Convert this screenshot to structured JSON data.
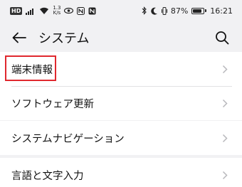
{
  "status_bar": {
    "badge": "HD",
    "speed_value": "1.3",
    "speed_unit": "K/s",
    "battery": "87%",
    "time": "16:21"
  },
  "header": {
    "title": "システム"
  },
  "groups": [
    {
      "items": [
        {
          "label": "端末情報"
        },
        {
          "label": "ソフトウェア更新"
        }
      ]
    },
    {
      "items": [
        {
          "label": "システムナビゲーション"
        }
      ]
    },
    {
      "items": [
        {
          "label": "言語と文字入力"
        }
      ]
    }
  ],
  "icons": {
    "back": "arrow-left-icon",
    "search": "search-icon",
    "chevron": "chevron-right-icon"
  },
  "colors": {
    "highlight": "#e0282e",
    "background": "#f1f1f3",
    "card": "#ffffff"
  }
}
